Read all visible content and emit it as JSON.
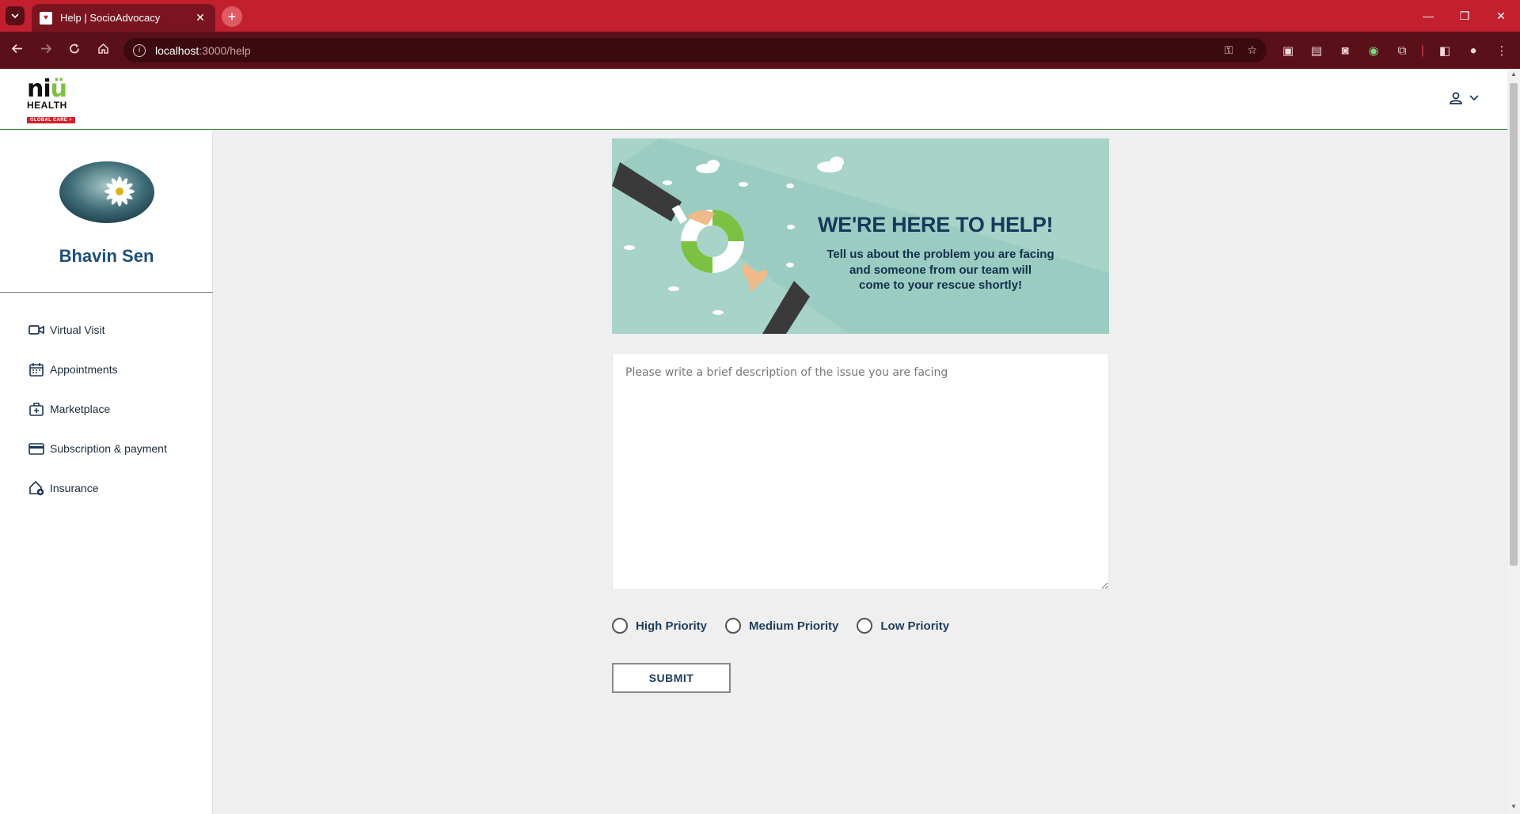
{
  "browser": {
    "tab_title": "Help | SocioAdvocacy",
    "url_host": "localhost",
    "url_path": ":3000/help",
    "win_min": "—",
    "win_restore": "❐",
    "win_close": "✕",
    "tab_close": "✕",
    "new_tab": "+"
  },
  "header": {
    "logo_mark_left": "ni",
    "logo_mark_right": "ü",
    "logo_health": "HEALTH",
    "logo_badge": "GLOBAL CARE +",
    "user_icon": "person-icon"
  },
  "sidebar": {
    "username": "Bhavin Sen",
    "items": [
      {
        "label": "Virtual Visit",
        "icon": "video-icon"
      },
      {
        "label": "Appointments",
        "icon": "calendar-icon"
      },
      {
        "label": "Marketplace",
        "icon": "medical-bag-icon"
      },
      {
        "label": "Subscription & payment",
        "icon": "credit-card-icon"
      },
      {
        "label": "Insurance",
        "icon": "home-insurance-icon"
      }
    ]
  },
  "banner": {
    "title": "WE'RE HERE TO HELP!",
    "text": "Tell us about the problem you are facing\nand someone from our team will\ncome to your rescue shortly!"
  },
  "form": {
    "description_placeholder": "Please write a brief description of the issue you are facing",
    "description_value": "",
    "priorities": [
      "High Priority",
      "Medium Priority",
      "Low Priority"
    ],
    "submit_label": "SUBMIT"
  },
  "colors": {
    "browser_accent": "#c2202e",
    "sidebar_name": "#1f4e79",
    "header_border": "#2e7d32",
    "banner_bg": "#a7d3c9"
  }
}
